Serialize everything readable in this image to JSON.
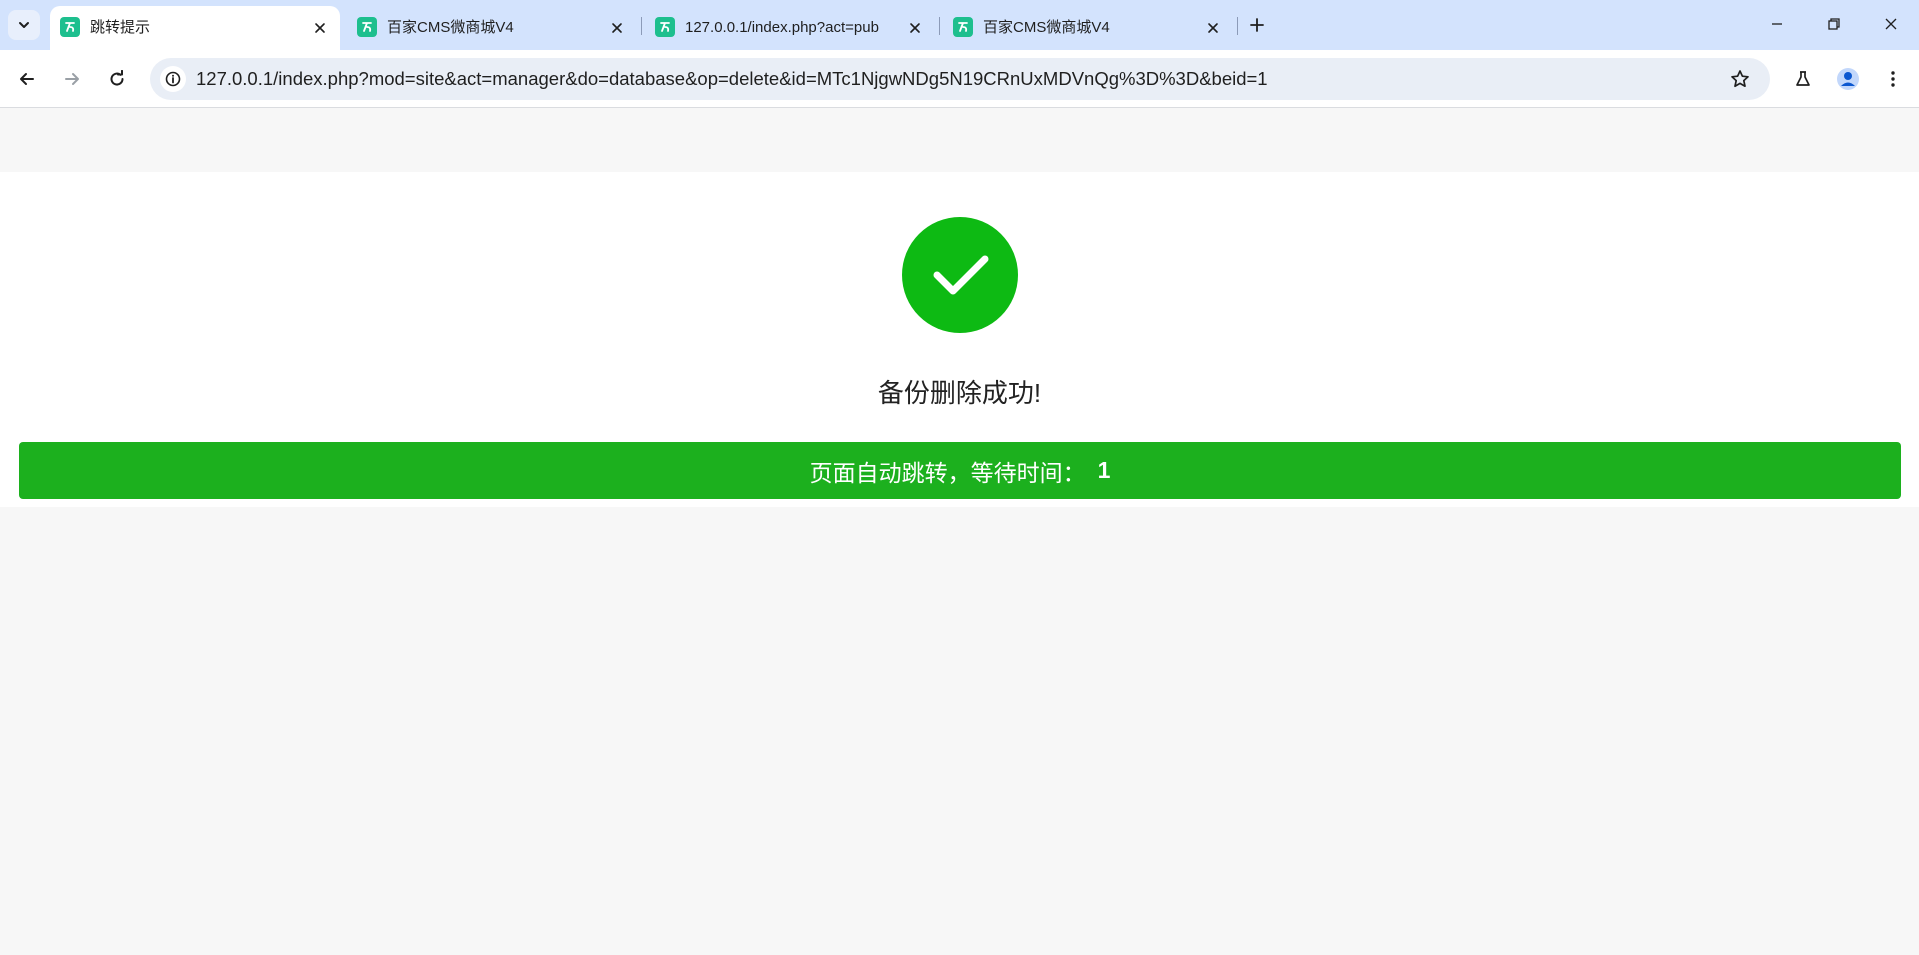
{
  "browser": {
    "tabs": [
      {
        "title": "跳转提示",
        "active": true
      },
      {
        "title": "百家CMS微商城V4",
        "active": false
      },
      {
        "title": "127.0.0.1/index.php?act=pub",
        "active": false
      },
      {
        "title": "百家CMS微商城V4",
        "active": false
      }
    ],
    "url": "127.0.0.1/index.php?mod=site&act=manager&do=database&op=delete&id=MTc1NjgwNDg5N19CRnUxMDVnQg%3D%3D&beid=1"
  },
  "page": {
    "message": "备份删除成功!",
    "redirect_label": "页面自动跳转，等待时间：",
    "redirect_seconds": "1"
  },
  "colors": {
    "success_icon": "#0dba13",
    "redirect_bar": "#1cb01e",
    "tabstrip": "#d3e3fd"
  },
  "icons": [
    "tab-search-icon",
    "favicon-icon",
    "close-icon",
    "plus-icon",
    "minimize-icon",
    "restore-icon",
    "back-icon",
    "forward-icon",
    "reload-icon",
    "info-icon",
    "star-icon",
    "labs-icon",
    "profile-icon",
    "menu-icon",
    "checkmark-icon"
  ]
}
